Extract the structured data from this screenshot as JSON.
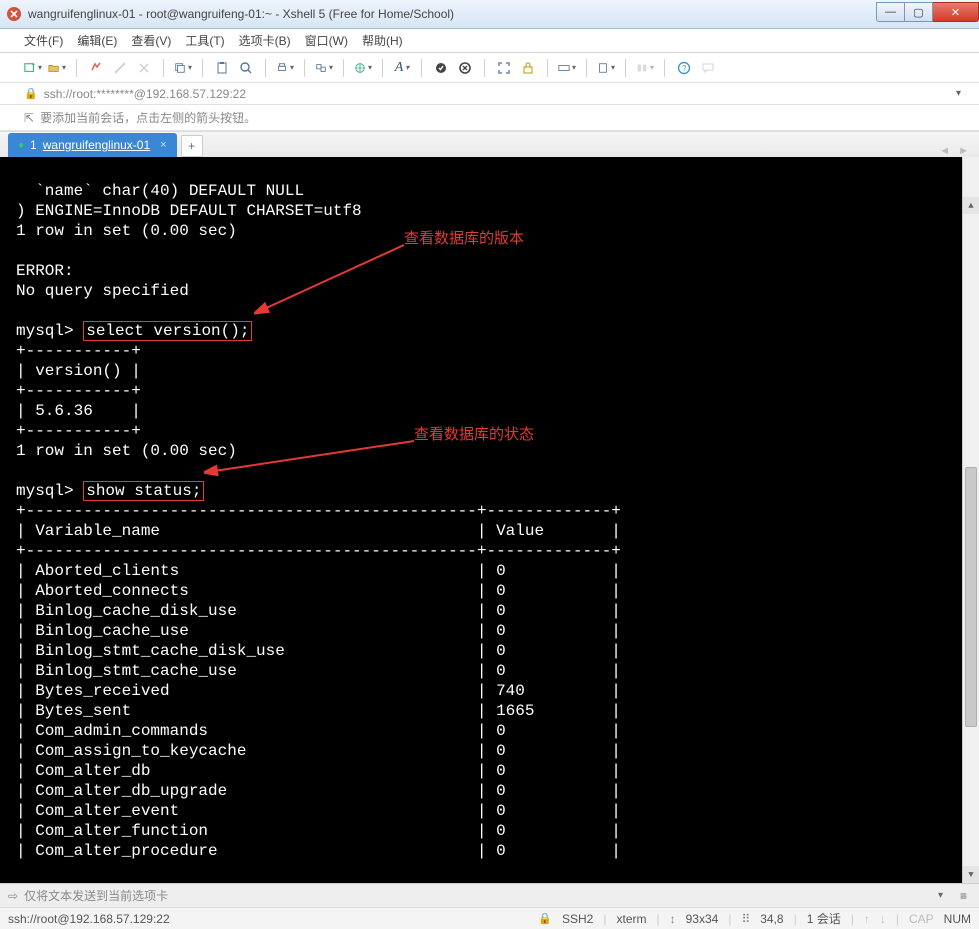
{
  "window": {
    "title": "wangruifenglinux-01 - root@wangruifeng-01:~ - Xshell 5 (Free for Home/School)"
  },
  "menu": {
    "file": "文件(F)",
    "edit": "编辑(E)",
    "view": "查看(V)",
    "tools": "工具(T)",
    "tabs": "选项卡(B)",
    "window": "窗口(W)",
    "help": "帮助(H)"
  },
  "address": {
    "url": "ssh://root:********@192.168.57.129:22"
  },
  "hint": {
    "text": "要添加当前会话，点击左侧的箭头按钮。"
  },
  "tab": {
    "num": "1",
    "name": "wangruifenglinux-01",
    "close": "×",
    "add": "+"
  },
  "terminal": {
    "line_name": "  `name` char(40) DEFAULT NULL",
    "line_engine": ") ENGINE=InnoDB DEFAULT CHARSET=utf8",
    "line_rows1": "1 row in set (0.00 sec)",
    "line_error": "ERROR:",
    "line_noquery": "No query specified",
    "prompt1": "mysql> ",
    "cmd1": "select version();",
    "sep1a": "+-----------+",
    "head1": "| version() |",
    "sep1b": "+-----------+",
    "val1": "| 5.6.36    |",
    "sep1c": "+-----------+",
    "line_rows2": "1 row in set (0.00 sec)",
    "prompt2": "mysql> ",
    "cmd2": "show status;",
    "sep2a": "+-----------------------------------------------+-------------+",
    "head2": "| Variable_name                                 | Value       |",
    "sep2b": "+-----------------------------------------------+-------------+",
    "rows": [
      "| Aborted_clients                               | 0           |",
      "| Aborted_connects                              | 0           |",
      "| Binlog_cache_disk_use                         | 0           |",
      "| Binlog_cache_use                              | 0           |",
      "| Binlog_stmt_cache_disk_use                    | 0           |",
      "| Binlog_stmt_cache_use                         | 0           |",
      "| Bytes_received                                | 740         |",
      "| Bytes_sent                                    | 1665        |",
      "| Com_admin_commands                            | 0           |",
      "| Com_assign_to_keycache                        | 0           |",
      "| Com_alter_db                                  | 0           |",
      "| Com_alter_db_upgrade                          | 0           |",
      "| Com_alter_event                               | 0           |",
      "| Com_alter_function                            | 0           |",
      "| Com_alter_procedure                           | 0           |"
    ],
    "annot1": "查看数据库的版本",
    "annot2": "查看数据库的状态"
  },
  "sendbar": {
    "placeholder": "仅将文本发送到当前选项卡"
  },
  "status": {
    "conn": "ssh://root@192.168.57.129:22",
    "proto_label": "SSH2",
    "term": "xterm",
    "size": "93x34",
    "pos": "34,8",
    "sessions": "1 会话",
    "cap": "CAP",
    "num": "NUM"
  },
  "icons": {
    "lock": "🔒",
    "send": "⇨",
    "proto_lock": "🔒",
    "size_arrows": "↕",
    "pos_icon": "⠿",
    "up": "↑",
    "down": "↓",
    "left": "◄",
    "right": "►",
    "scr_up": "▲",
    "scr_dn": "▼"
  }
}
